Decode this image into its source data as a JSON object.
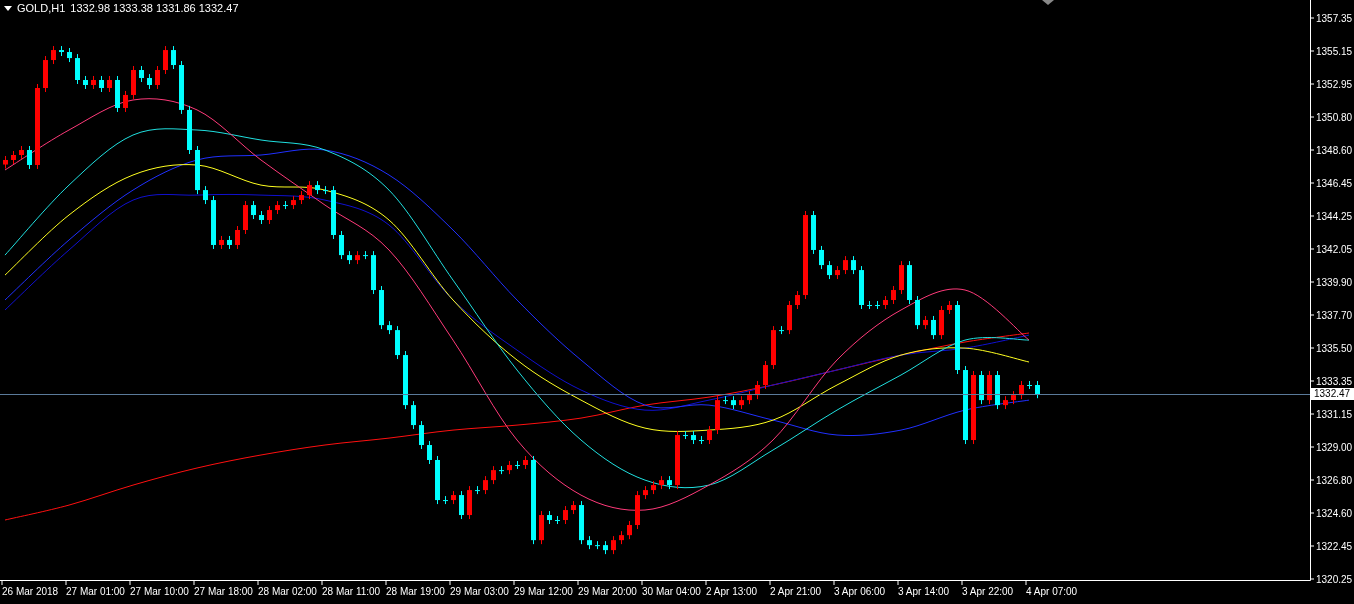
{
  "header": {
    "symbol": "GOLD,H1",
    "prices": "1332.98 1333.38 1331.86 1332.47"
  },
  "chart": {
    "price_labels": [
      "1357.35",
      "1355.15",
      "1352.95",
      "1350.80",
      "1348.60",
      "1346.45",
      "1344.25",
      "1342.05",
      "1339.90",
      "1337.70",
      "1335.50",
      "1333.35",
      "1331.15",
      "1329.00",
      "1326.80",
      "1324.60",
      "1322.45",
      "1320.25"
    ],
    "time_labels": [
      "26 Mar 2018",
      "27 Mar 01:00",
      "27 Mar 10:00",
      "27 Mar 18:00",
      "28 Mar 02:00",
      "28 Mar 11:00",
      "28 Mar 19:00",
      "29 Mar 03:00",
      "29 Mar 12:00",
      "29 Mar 20:00",
      "30 Mar 04:00",
      "2 Apr 13:00",
      "2 Apr 21:00",
      "3 Apr 06:00",
      "3 Apr 14:00",
      "3 Apr 22:00",
      "4 Apr 07:00"
    ],
    "current_price": "1332.47"
  }
}
